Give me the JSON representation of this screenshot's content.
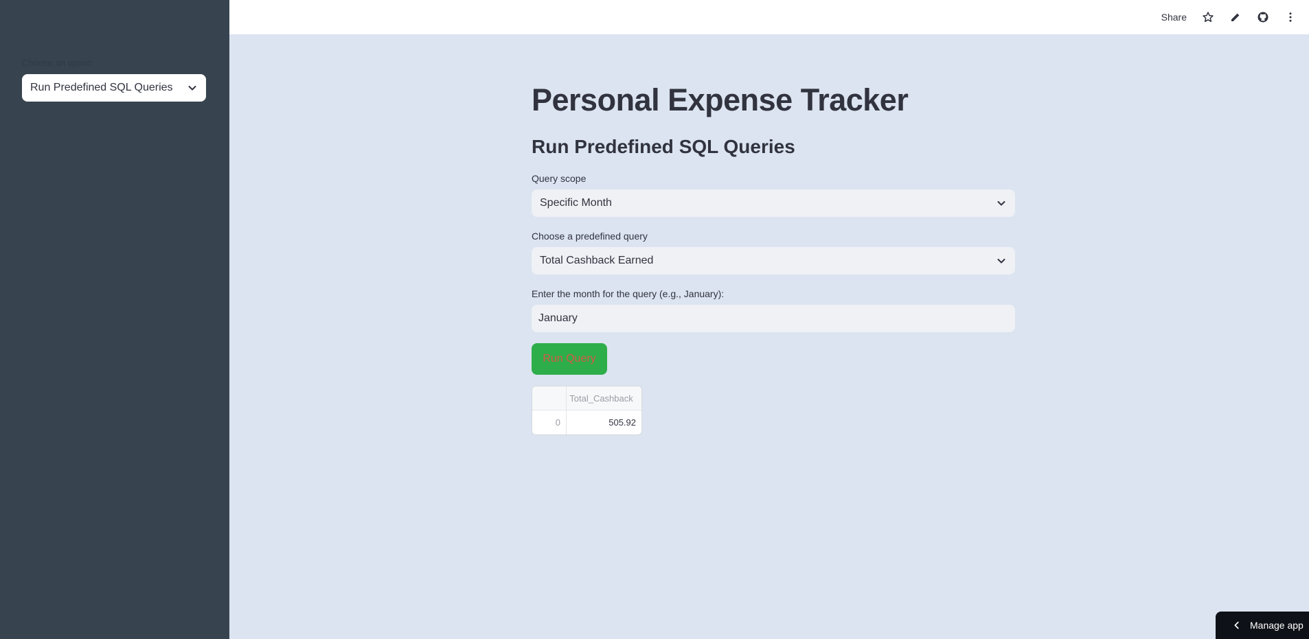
{
  "sidebar": {
    "label": "Choose an option",
    "selected": "Run Predefined SQL Queries"
  },
  "header": {
    "share_label": "Share",
    "icons": [
      "star-icon",
      "pencil-icon",
      "github-icon",
      "more-vertical-icon"
    ]
  },
  "main": {
    "title": "Personal Expense Tracker",
    "subtitle": "Run Predefined SQL Queries",
    "query_scope": {
      "label": "Query scope",
      "value": "Specific Month"
    },
    "predefined_query": {
      "label": "Choose a predefined query",
      "value": "Total Cashback Earned"
    },
    "month_input": {
      "label": "Enter the month for the query (e.g., January):",
      "value": "January"
    },
    "run_button": "Run Query",
    "result_table": {
      "columns": [
        "",
        "Total_Cashback"
      ],
      "rows": [
        [
          "0",
          "505.92"
        ]
      ]
    }
  },
  "manage_app": "Manage app",
  "colors": {
    "sidebar_bg": "#37444f",
    "main_bg": "#dbe4f0",
    "button_bg": "#2eae4a",
    "button_text": "#d65a47"
  }
}
